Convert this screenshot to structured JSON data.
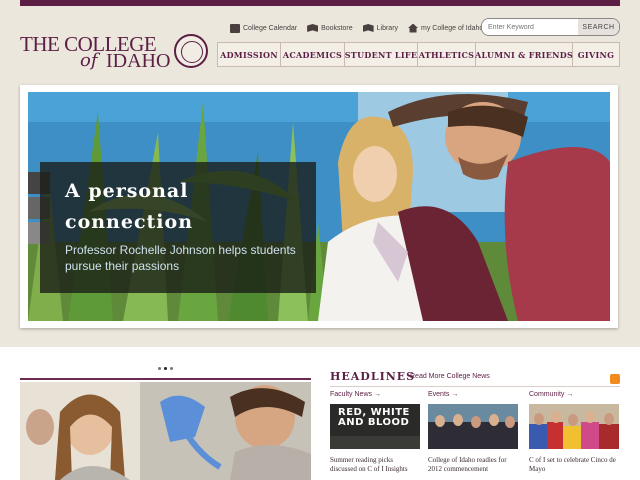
{
  "logo": {
    "line1": "THE COLLEGE",
    "of": "of",
    "line2": "IDAHO"
  },
  "utility": {
    "items": [
      {
        "label": "College Calendar",
        "icon": "calendar-icon"
      },
      {
        "label": "Bookstore",
        "icon": "book-icon"
      },
      {
        "label": "Library",
        "icon": "library-icon"
      },
      {
        "label": "my College of Idaho",
        "icon": "house-icon"
      }
    ]
  },
  "search": {
    "placeholder": "Enter Keyword",
    "button_label": "SEARCH"
  },
  "nav": {
    "items": [
      "ADMISSION",
      "ACADEMICS",
      "STUDENT LIFE",
      "ATHLETICS",
      "ALUMNI & FRIENDS",
      "GIVING"
    ]
  },
  "hero": {
    "title": "A personal connection",
    "subtitle": "Professor Rochelle Johnson helps students pursue their passions"
  },
  "slider": {
    "dot_count": 3,
    "active_index": 1
  },
  "headlines": {
    "title": "HEADLINES",
    "more_link": "Read More College News",
    "columns": [
      {
        "category": "Faculty News →",
        "thumb_text": "RED, WHITE AND BLOOD",
        "caption": "Summer reading picks discussed on C of I Insights"
      },
      {
        "category": "Events →",
        "thumb_text": "",
        "caption": "College of Idaho readies for 2012 commencement"
      },
      {
        "category": "Community →",
        "thumb_text": "",
        "caption": "C of I set to celebrate Cinco de Mayo"
      }
    ]
  },
  "colors": {
    "brand": "#5b1e45",
    "background": "#ece7dd",
    "rss": "#f28a1e"
  }
}
